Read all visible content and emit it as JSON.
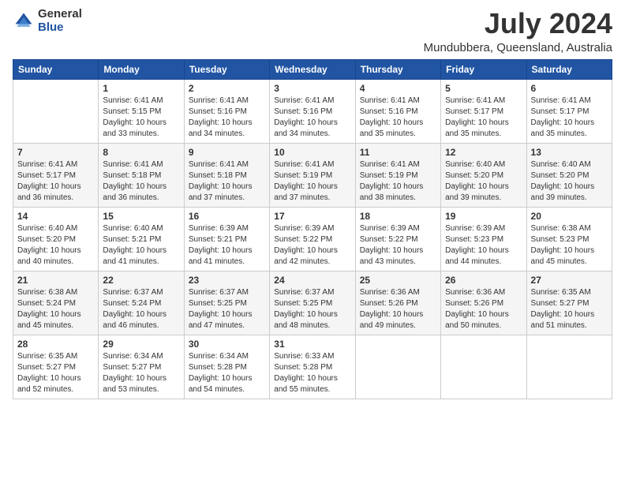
{
  "header": {
    "logo_general": "General",
    "logo_blue": "Blue",
    "title": "July 2024",
    "subtitle": "Mundubbera, Queensland, Australia"
  },
  "calendar": {
    "days_of_week": [
      "Sunday",
      "Monday",
      "Tuesday",
      "Wednesday",
      "Thursday",
      "Friday",
      "Saturday"
    ],
    "weeks": [
      [
        {
          "day": "",
          "info": ""
        },
        {
          "day": "1",
          "info": "Sunrise: 6:41 AM\nSunset: 5:15 PM\nDaylight: 10 hours\nand 33 minutes."
        },
        {
          "day": "2",
          "info": "Sunrise: 6:41 AM\nSunset: 5:16 PM\nDaylight: 10 hours\nand 34 minutes."
        },
        {
          "day": "3",
          "info": "Sunrise: 6:41 AM\nSunset: 5:16 PM\nDaylight: 10 hours\nand 34 minutes."
        },
        {
          "day": "4",
          "info": "Sunrise: 6:41 AM\nSunset: 5:16 PM\nDaylight: 10 hours\nand 35 minutes."
        },
        {
          "day": "5",
          "info": "Sunrise: 6:41 AM\nSunset: 5:17 PM\nDaylight: 10 hours\nand 35 minutes."
        },
        {
          "day": "6",
          "info": "Sunrise: 6:41 AM\nSunset: 5:17 PM\nDaylight: 10 hours\nand 35 minutes."
        }
      ],
      [
        {
          "day": "7",
          "info": "Sunrise: 6:41 AM\nSunset: 5:17 PM\nDaylight: 10 hours\nand 36 minutes."
        },
        {
          "day": "8",
          "info": "Sunrise: 6:41 AM\nSunset: 5:18 PM\nDaylight: 10 hours\nand 36 minutes."
        },
        {
          "day": "9",
          "info": "Sunrise: 6:41 AM\nSunset: 5:18 PM\nDaylight: 10 hours\nand 37 minutes."
        },
        {
          "day": "10",
          "info": "Sunrise: 6:41 AM\nSunset: 5:19 PM\nDaylight: 10 hours\nand 37 minutes."
        },
        {
          "day": "11",
          "info": "Sunrise: 6:41 AM\nSunset: 5:19 PM\nDaylight: 10 hours\nand 38 minutes."
        },
        {
          "day": "12",
          "info": "Sunrise: 6:40 AM\nSunset: 5:20 PM\nDaylight: 10 hours\nand 39 minutes."
        },
        {
          "day": "13",
          "info": "Sunrise: 6:40 AM\nSunset: 5:20 PM\nDaylight: 10 hours\nand 39 minutes."
        }
      ],
      [
        {
          "day": "14",
          "info": "Sunrise: 6:40 AM\nSunset: 5:20 PM\nDaylight: 10 hours\nand 40 minutes."
        },
        {
          "day": "15",
          "info": "Sunrise: 6:40 AM\nSunset: 5:21 PM\nDaylight: 10 hours\nand 41 minutes."
        },
        {
          "day": "16",
          "info": "Sunrise: 6:39 AM\nSunset: 5:21 PM\nDaylight: 10 hours\nand 41 minutes."
        },
        {
          "day": "17",
          "info": "Sunrise: 6:39 AM\nSunset: 5:22 PM\nDaylight: 10 hours\nand 42 minutes."
        },
        {
          "day": "18",
          "info": "Sunrise: 6:39 AM\nSunset: 5:22 PM\nDaylight: 10 hours\nand 43 minutes."
        },
        {
          "day": "19",
          "info": "Sunrise: 6:39 AM\nSunset: 5:23 PM\nDaylight: 10 hours\nand 44 minutes."
        },
        {
          "day": "20",
          "info": "Sunrise: 6:38 AM\nSunset: 5:23 PM\nDaylight: 10 hours\nand 45 minutes."
        }
      ],
      [
        {
          "day": "21",
          "info": "Sunrise: 6:38 AM\nSunset: 5:24 PM\nDaylight: 10 hours\nand 45 minutes."
        },
        {
          "day": "22",
          "info": "Sunrise: 6:37 AM\nSunset: 5:24 PM\nDaylight: 10 hours\nand 46 minutes."
        },
        {
          "day": "23",
          "info": "Sunrise: 6:37 AM\nSunset: 5:25 PM\nDaylight: 10 hours\nand 47 minutes."
        },
        {
          "day": "24",
          "info": "Sunrise: 6:37 AM\nSunset: 5:25 PM\nDaylight: 10 hours\nand 48 minutes."
        },
        {
          "day": "25",
          "info": "Sunrise: 6:36 AM\nSunset: 5:26 PM\nDaylight: 10 hours\nand 49 minutes."
        },
        {
          "day": "26",
          "info": "Sunrise: 6:36 AM\nSunset: 5:26 PM\nDaylight: 10 hours\nand 50 minutes."
        },
        {
          "day": "27",
          "info": "Sunrise: 6:35 AM\nSunset: 5:27 PM\nDaylight: 10 hours\nand 51 minutes."
        }
      ],
      [
        {
          "day": "28",
          "info": "Sunrise: 6:35 AM\nSunset: 5:27 PM\nDaylight: 10 hours\nand 52 minutes."
        },
        {
          "day": "29",
          "info": "Sunrise: 6:34 AM\nSunset: 5:27 PM\nDaylight: 10 hours\nand 53 minutes."
        },
        {
          "day": "30",
          "info": "Sunrise: 6:34 AM\nSunset: 5:28 PM\nDaylight: 10 hours\nand 54 minutes."
        },
        {
          "day": "31",
          "info": "Sunrise: 6:33 AM\nSunset: 5:28 PM\nDaylight: 10 hours\nand 55 minutes."
        },
        {
          "day": "",
          "info": ""
        },
        {
          "day": "",
          "info": ""
        },
        {
          "day": "",
          "info": ""
        }
      ]
    ]
  }
}
